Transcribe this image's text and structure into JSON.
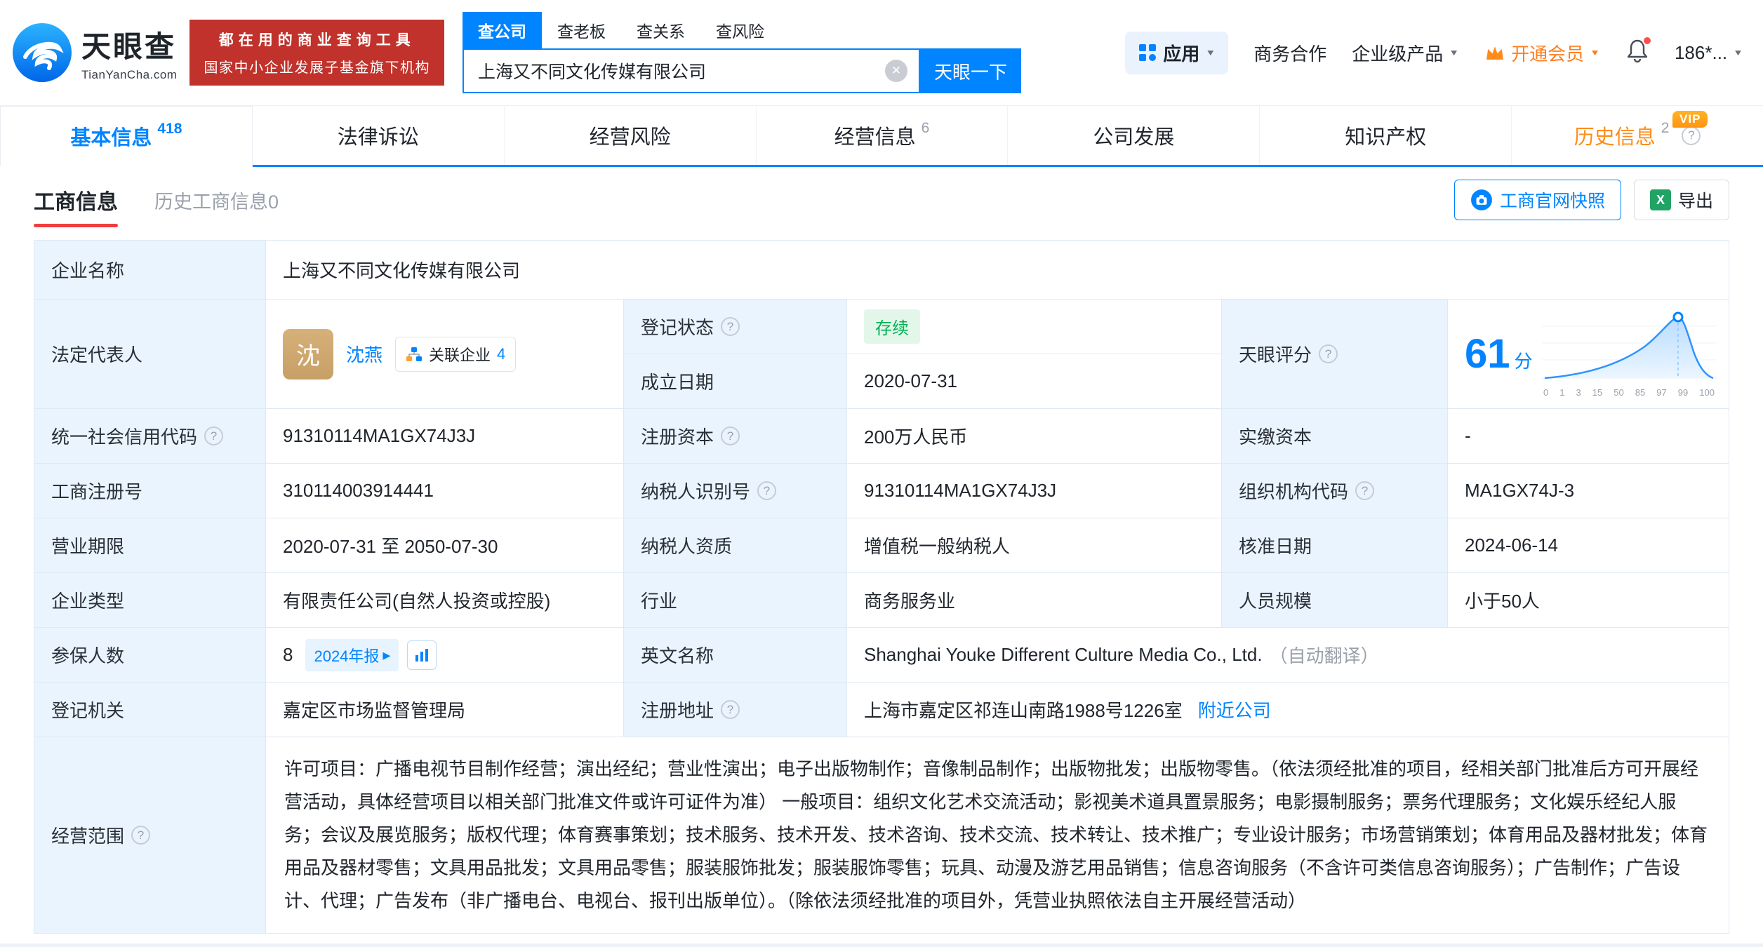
{
  "brand": {
    "name": "天眼查",
    "domain": "TianYanCha.com",
    "slogan_line1": "都在用的商业查询工具",
    "slogan_line2": "国家中小企业发展子基金旗下机构"
  },
  "icons": {
    "caret_down": "▼",
    "help": "?",
    "clear": "✕",
    "tag_caret": "▸"
  },
  "search": {
    "tabs": [
      {
        "label": "查公司"
      },
      {
        "label": "查老板"
      },
      {
        "label": "查关系"
      },
      {
        "label": "查风险"
      }
    ],
    "value": "上海又不同文化传媒有限公司",
    "button": "天眼一下"
  },
  "topnav": {
    "apps": "应用",
    "cooperation": "商务合作",
    "enterprise_products": "企业级产品",
    "vip": "开通会员",
    "account": "186*..."
  },
  "tabs": {
    "items": [
      {
        "label": "基本信息",
        "count": "418"
      },
      {
        "label": "法律诉讼",
        "count": ""
      },
      {
        "label": "经营风险",
        "count": ""
      },
      {
        "label": "经营信息",
        "count": "6"
      },
      {
        "label": "公司发展",
        "count": ""
      },
      {
        "label": "知识产权",
        "count": ""
      },
      {
        "label": "历史信息",
        "count": "2",
        "vip": "VIP"
      }
    ]
  },
  "subtabs": {
    "business_info": "工商信息",
    "history_business_info": "历史工商信息0",
    "snapshot_button": "工商官网快照",
    "export_button": "导出"
  },
  "table": {
    "company_name_label": "企业名称",
    "company_name": "上海又不同文化传媒有限公司",
    "legal_rep_label": "法定代表人",
    "legal_rep_avatar": "沈",
    "legal_rep_name": "沈燕",
    "related_companies_label": "关联企业",
    "related_companies_count": "4",
    "reg_status_label": "登记状态",
    "reg_status": "存续",
    "established_label": "成立日期",
    "established": "2020-07-31",
    "score_label": "天眼评分",
    "score": "61",
    "score_unit": "分",
    "score_ticks": [
      "0",
      "1",
      "3",
      "15",
      "50",
      "85",
      "97",
      "99",
      "100"
    ],
    "credit_code_label": "统一社会信用代码",
    "credit_code": "91310114MA1GX74J3J",
    "reg_capital_label": "注册资本",
    "reg_capital": "200万人民币",
    "paid_capital_label": "实缴资本",
    "paid_capital": "-",
    "reg_no_label": "工商注册号",
    "reg_no": "310114003914441",
    "taxpayer_no_label": "纳税人识别号",
    "taxpayer_no": "91310114MA1GX74J3J",
    "org_code_label": "组织机构代码",
    "org_code": "MA1GX74J-3",
    "term_label": "营业期限",
    "term": "2020-07-31 至 2050-07-30",
    "taxpayer_quality_label": "纳税人资质",
    "taxpayer_quality": "增值税一般纳税人",
    "approved_label": "核准日期",
    "approved": "2024-06-14",
    "type_label": "企业类型",
    "type": "有限责任公司(自然人投资或控股)",
    "industry_label": "行业",
    "industry": "商务服务业",
    "staff_label": "人员规模",
    "staff": "小于50人",
    "insured_label": "参保人数",
    "insured": "8",
    "annual_report": "2024年报",
    "english_label": "英文名称",
    "english_name": "Shanghai Youke Different Culture Media Co., Ltd.",
    "english_note": "（自动翻译）",
    "authority_label": "登记机关",
    "authority": "嘉定区市场监督管理局",
    "address_label": "注册地址",
    "address": "上海市嘉定区祁连山南路1988号1226室",
    "nearby_link": "附近公司",
    "scope_label": "经营范围",
    "scope": "许可项目：广播电视节目制作经营；演出经纪；营业性演出；电子出版物制作；音像制品制作；出版物批发；出版物零售。（依法须经批准的项目，经相关部门批准后方可开展经营活动，具体经营项目以相关部门批准文件或许可证件为准） 一般项目：组织文化艺术交流活动；影视美术道具置景服务；电影摄制服务；票务代理服务；文化娱乐经纪人服务；会议及展览服务；版权代理；体育赛事策划；技术服务、技术开发、技术咨询、技术交流、技术转让、技术推广；专业设计服务；市场营销策划；体育用品及器材批发；体育用品及器材零售；文具用品批发；文具用品零售；服装服饰批发；服装服饰零售；玩具、动漫及游艺用品销售；信息咨询服务（不含许可类信息咨询服务）；广告制作；广告设计、代理；广告发布（非广播电台、电视台、报刊出版单位）。（除依法须经批准的项目外，凭营业执照依法自主开展经营活动）"
  },
  "colors": {
    "primary_blue": "#0084ff",
    "label_bg": "#eaf4fe",
    "border": "#dfe9f2",
    "status_green": "#00b152",
    "vip_orange": "#ff8c1a",
    "slogan_red": "#c0322b"
  }
}
